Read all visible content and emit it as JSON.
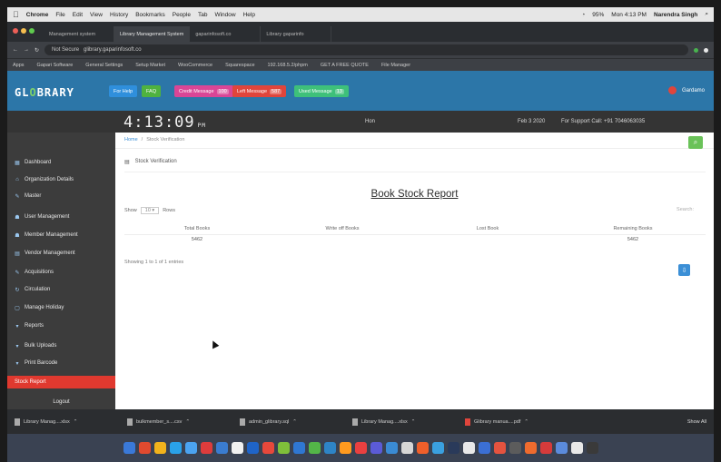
{
  "menubar": {
    "apple": "",
    "app": "Chrome",
    "items": [
      "File",
      "Edit",
      "View",
      "History",
      "Bookmarks",
      "People",
      "Tab",
      "Window",
      "Help"
    ],
    "battery": "95%",
    "datetime": "Mon 4:13 PM",
    "user": "Narendra Singh"
  },
  "tabs": [
    {
      "label": "Management system",
      "active": false
    },
    {
      "label": "Library Management System",
      "active": true
    },
    {
      "label": "gaparinfosoft.co",
      "active": false
    },
    {
      "label": "Library gaparinfo",
      "active": false
    }
  ],
  "address": {
    "secure_label": "Not Secure",
    "url": "glibrary.gaparinfosoft.co"
  },
  "bookmarks": [
    "Apps",
    "Gapari Software",
    "General Settings",
    "Setup Market",
    "WooCommerce",
    "Squarespace",
    "192.168.5.2/phpm",
    "GET A FREE QUOTE",
    "File Manager"
  ],
  "header": {
    "logo_prefix": "GL",
    "logo_o": "O",
    "logo_suffix": "BRARY",
    "buttons": [
      {
        "label": "For Help",
        "badge": "",
        "color": "#2f8fdc"
      },
      {
        "label": "FAQ",
        "badge": "",
        "color": "#4fb23f"
      },
      {
        "label": "Credit Message",
        "badge": "100",
        "color": "#d94696"
      },
      {
        "label": "Left Message",
        "badge": "587",
        "color": "#e0453c"
      },
      {
        "label": "Used Message",
        "badge": "13",
        "color": "#3ec07a"
      }
    ],
    "user_name": "Gardamo"
  },
  "clockbar": {
    "time": "4:13:09",
    "ampm": "PM",
    "center": "Hon",
    "date": "Feb 3 2020",
    "support": "For Support Call: +91 7046063035"
  },
  "sidebar": [
    {
      "icon": "▦",
      "icon_name": "dashboard-icon",
      "label": "Dashboard",
      "active": false
    },
    {
      "icon": "⌂",
      "icon_name": "organization-icon",
      "label": "Organization Details",
      "active": false
    },
    {
      "icon": "✎",
      "icon_name": "master-icon",
      "label": "Master",
      "active": false
    },
    {
      "icon": "☗",
      "icon_name": "user-icon",
      "label": "User Management",
      "active": false
    },
    {
      "icon": "☗",
      "icon_name": "member-icon",
      "label": "Member Management",
      "active": false
    },
    {
      "icon": "▤",
      "icon_name": "vendor-icon",
      "label": "Vendor Management",
      "active": false
    },
    {
      "icon": "✎",
      "icon_name": "acquisitions-icon",
      "label": "Acquisitions",
      "active": false
    },
    {
      "icon": "↻",
      "icon_name": "circulation-icon",
      "label": "Circulation",
      "active": false
    },
    {
      "icon": "▢",
      "icon_name": "holiday-icon",
      "label": "Manage Holiday",
      "active": false
    },
    {
      "icon": "▾",
      "icon_name": "reports-icon",
      "label": "Reports",
      "active": false
    },
    {
      "icon": "▾",
      "icon_name": "bulk-upload-icon",
      "label": "Bulk Uploads",
      "active": false
    },
    {
      "icon": "▾",
      "icon_name": "barcode-icon",
      "label": "Print Barcode",
      "active": false
    },
    {
      "icon": "",
      "icon_name": "",
      "label": "Stock Report",
      "active": true
    },
    {
      "icon": "",
      "icon_name": "",
      "label": "Logout",
      "active": false
    }
  ],
  "main": {
    "breadcrumb_home": "Home",
    "breadcrumb_sep": "/",
    "breadcrumb_current": "Stock Verification",
    "section_title": "Stock Verification",
    "report_title": "Book Stock Report",
    "show_label": "Show",
    "show_value": "10",
    "rows_label": "Rows",
    "search_label": "Search:",
    "columns": [
      "Total Books",
      "Write off Books",
      "Lost Book",
      "Remaining Books"
    ],
    "rows": [
      [
        "5462",
        "",
        "",
        "5462"
      ]
    ],
    "showing": "Showing 1 to 1 of 1 entries"
  },
  "downloads": [
    {
      "label": "Library Manag....xlsx"
    },
    {
      "label": "bulkmember_s....csv"
    },
    {
      "label": "admin_glibrary.sql"
    },
    {
      "label": "Library Manag....xlsx"
    },
    {
      "label": "Glibrary manua....pdf"
    }
  ],
  "downloads_show_all": "Show All",
  "dock_colors": [
    "#3a79d8",
    "#e04a2f",
    "#f2b31c",
    "#2aa1e8",
    "#4ba3f0",
    "#dd3c3c",
    "#3a7cd0",
    "#f0f0f0",
    "#1f64c8",
    "#e7483b",
    "#7fbf3a",
    "#2f77d2",
    "#53b548",
    "#2e84c6",
    "#ff9a1f",
    "#e94040",
    "#5b5bd6",
    "#3a8bd4",
    "#d6d6d6",
    "#ef5f2a",
    "#3aa0e0",
    "#2a3a5a",
    "#e8e8e8",
    "#3b6fd4",
    "#e5533f",
    "#5c5c5c",
    "#ef6b2e",
    "#d53b3b",
    "#5b8bdc",
    "#e8e8e8",
    "#3a3a3a"
  ]
}
